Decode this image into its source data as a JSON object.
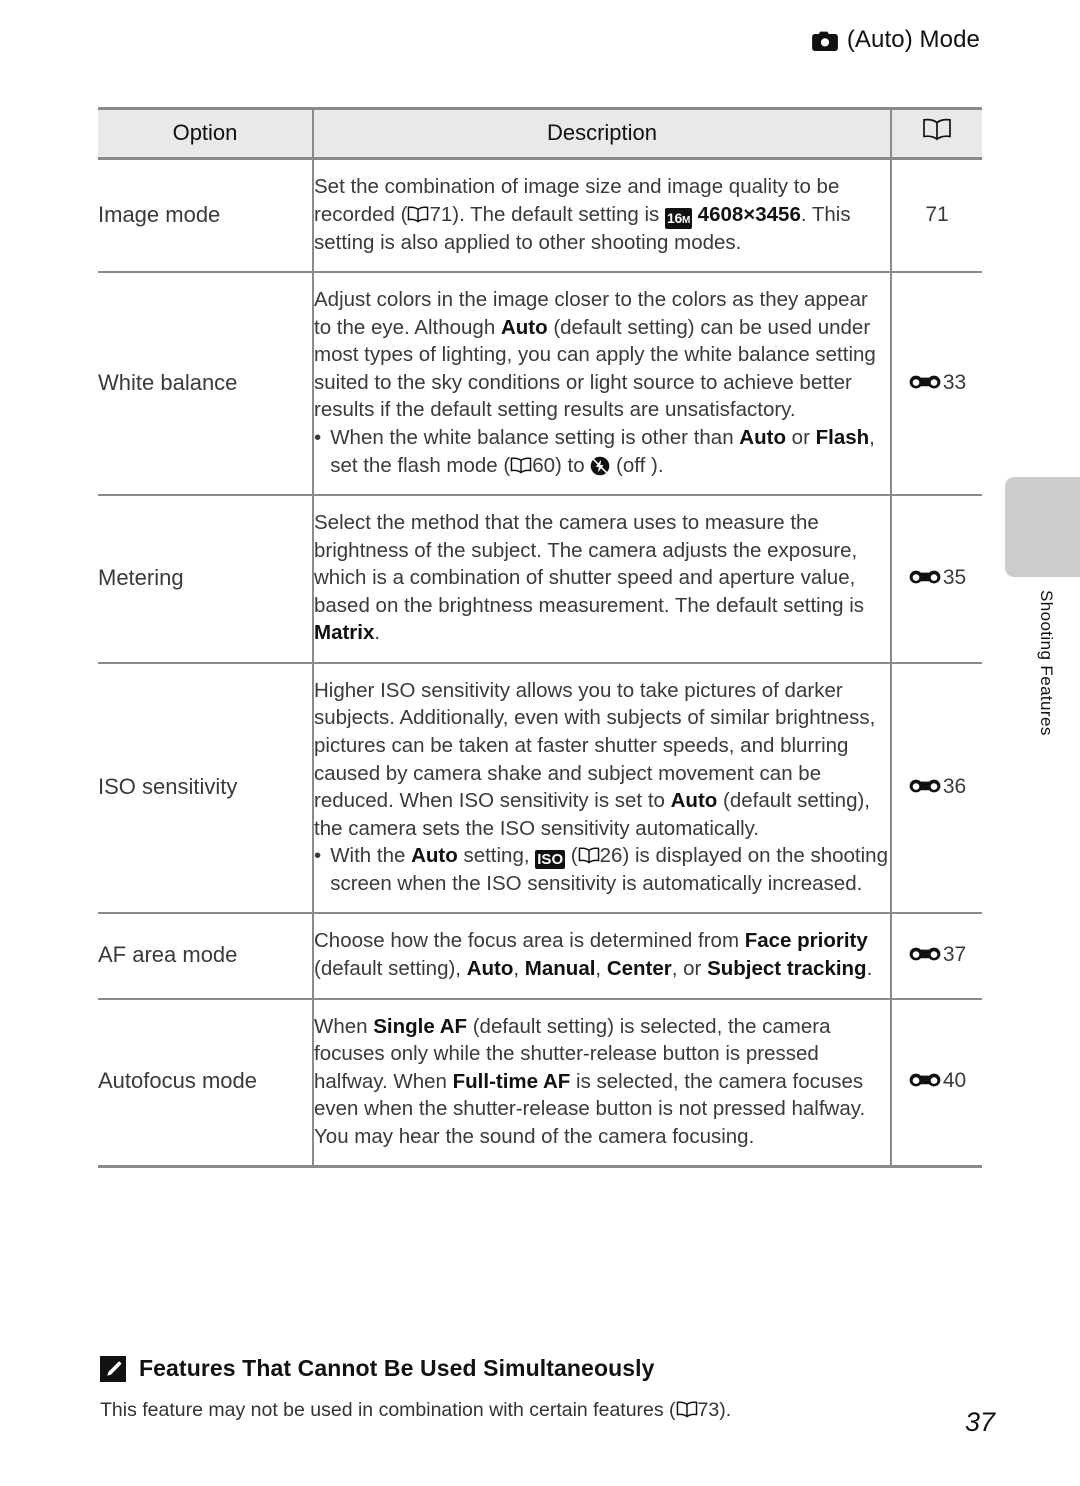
{
  "running_head": {
    "icon": "camera-icon",
    "text": "(Auto) Mode"
  },
  "side_tab": {
    "label": "Shooting Features"
  },
  "table": {
    "headers": {
      "option": "Option",
      "description": "Description",
      "reference": "book-icon"
    },
    "rows": [
      {
        "option": "Image mode",
        "ref": "71",
        "ref_icon": "none",
        "desc_parts": [
          {
            "t": "Set the combination of image size and image quality to be recorded ("
          },
          {
            "icon": "book-icon"
          },
          {
            "t": "71). The default setting is "
          },
          {
            "icon": "badge-16m"
          },
          {
            "t": " "
          },
          {
            "b": "4608×3456"
          },
          {
            "t": ". This setting is also applied to other shooting modes."
          }
        ]
      },
      {
        "option": "White balance",
        "ref": "33",
        "ref_icon": "e-marker-icon",
        "desc_parts": [
          {
            "t": "Adjust colors in the image closer to the colors as they appear to the eye. Although "
          },
          {
            "b": "Auto"
          },
          {
            "t": " (default setting) can be used under most types of lighting, you can apply the white balance setting suited to the sky conditions or light source to achieve better results if the default setting results are unsatisfactory."
          }
        ],
        "bullets": [
          [
            {
              "t": "When the white balance setting is other than "
            },
            {
              "b": "Auto"
            },
            {
              "t": " or "
            },
            {
              "b": "Flash"
            },
            {
              "t": ", set the flash mode ("
            },
            {
              "icon": "book-icon"
            },
            {
              "t": "60) to "
            },
            {
              "icon": "flash-off-icon"
            },
            {
              "t": " (off )."
            }
          ]
        ]
      },
      {
        "option": "Metering",
        "ref": "35",
        "ref_icon": "e-marker-icon",
        "desc_parts": [
          {
            "t": "Select the method that the camera uses to measure the brightness of the subject. The camera adjusts the exposure, which is a combination of shutter speed and aperture value, based on the brightness measurement. The default setting is "
          },
          {
            "b": "Matrix"
          },
          {
            "t": "."
          }
        ]
      },
      {
        "option": "ISO sensitivity",
        "ref": "36",
        "ref_icon": "e-marker-icon",
        "desc_parts": [
          {
            "t": "Higher ISO sensitivity allows you to take pictures of darker subjects. Additionally, even with subjects of similar brightness, pictures can be taken at faster shutter speeds, and blurring caused by camera shake and subject movement can be reduced. When ISO sensitivity is set to "
          },
          {
            "b": "Auto"
          },
          {
            "t": " (default setting), the camera sets the ISO sensitivity automatically."
          }
        ],
        "bullets": [
          [
            {
              "t": "With the "
            },
            {
              "b": "Auto"
            },
            {
              "t": " setting, "
            },
            {
              "icon": "badge-iso"
            },
            {
              "t": " ("
            },
            {
              "icon": "book-icon"
            },
            {
              "t": "26) is displayed on the shooting screen when the ISO sensitivity is automatically increased."
            }
          ]
        ]
      },
      {
        "option": "AF area mode",
        "ref": "37",
        "ref_icon": "e-marker-icon",
        "desc_parts": [
          {
            "t": "Choose how the focus area is determined from "
          },
          {
            "b": "Face priority"
          },
          {
            "t": " (default setting), "
          },
          {
            "b": "Auto"
          },
          {
            "t": ", "
          },
          {
            "b": "Manual"
          },
          {
            "t": ", "
          },
          {
            "b": "Center"
          },
          {
            "t": ",  or "
          },
          {
            "b": "Subject tracking"
          },
          {
            "t": "."
          }
        ]
      },
      {
        "option": "Autofocus mode",
        "ref": "40",
        "ref_icon": "e-marker-icon",
        "desc_parts": [
          {
            "t": "When "
          },
          {
            "b": "Single AF"
          },
          {
            "t": " (default setting) is selected, the camera focuses only while the shutter-release button is pressed halfway. When "
          },
          {
            "b": "Full-time AF"
          },
          {
            "t": " is selected, the camera focuses even when the shutter-release button is not pressed halfway. You may hear the sound of the camera focusing."
          }
        ]
      }
    ]
  },
  "note": {
    "icon": "pencil-note-icon",
    "title": "Features That Cannot Be Used Simultaneously",
    "body_parts": [
      {
        "t": "This feature may not be used in combination with certain features ("
      },
      {
        "icon": "book-icon"
      },
      {
        "t": "73)."
      }
    ]
  },
  "page_number": "37"
}
